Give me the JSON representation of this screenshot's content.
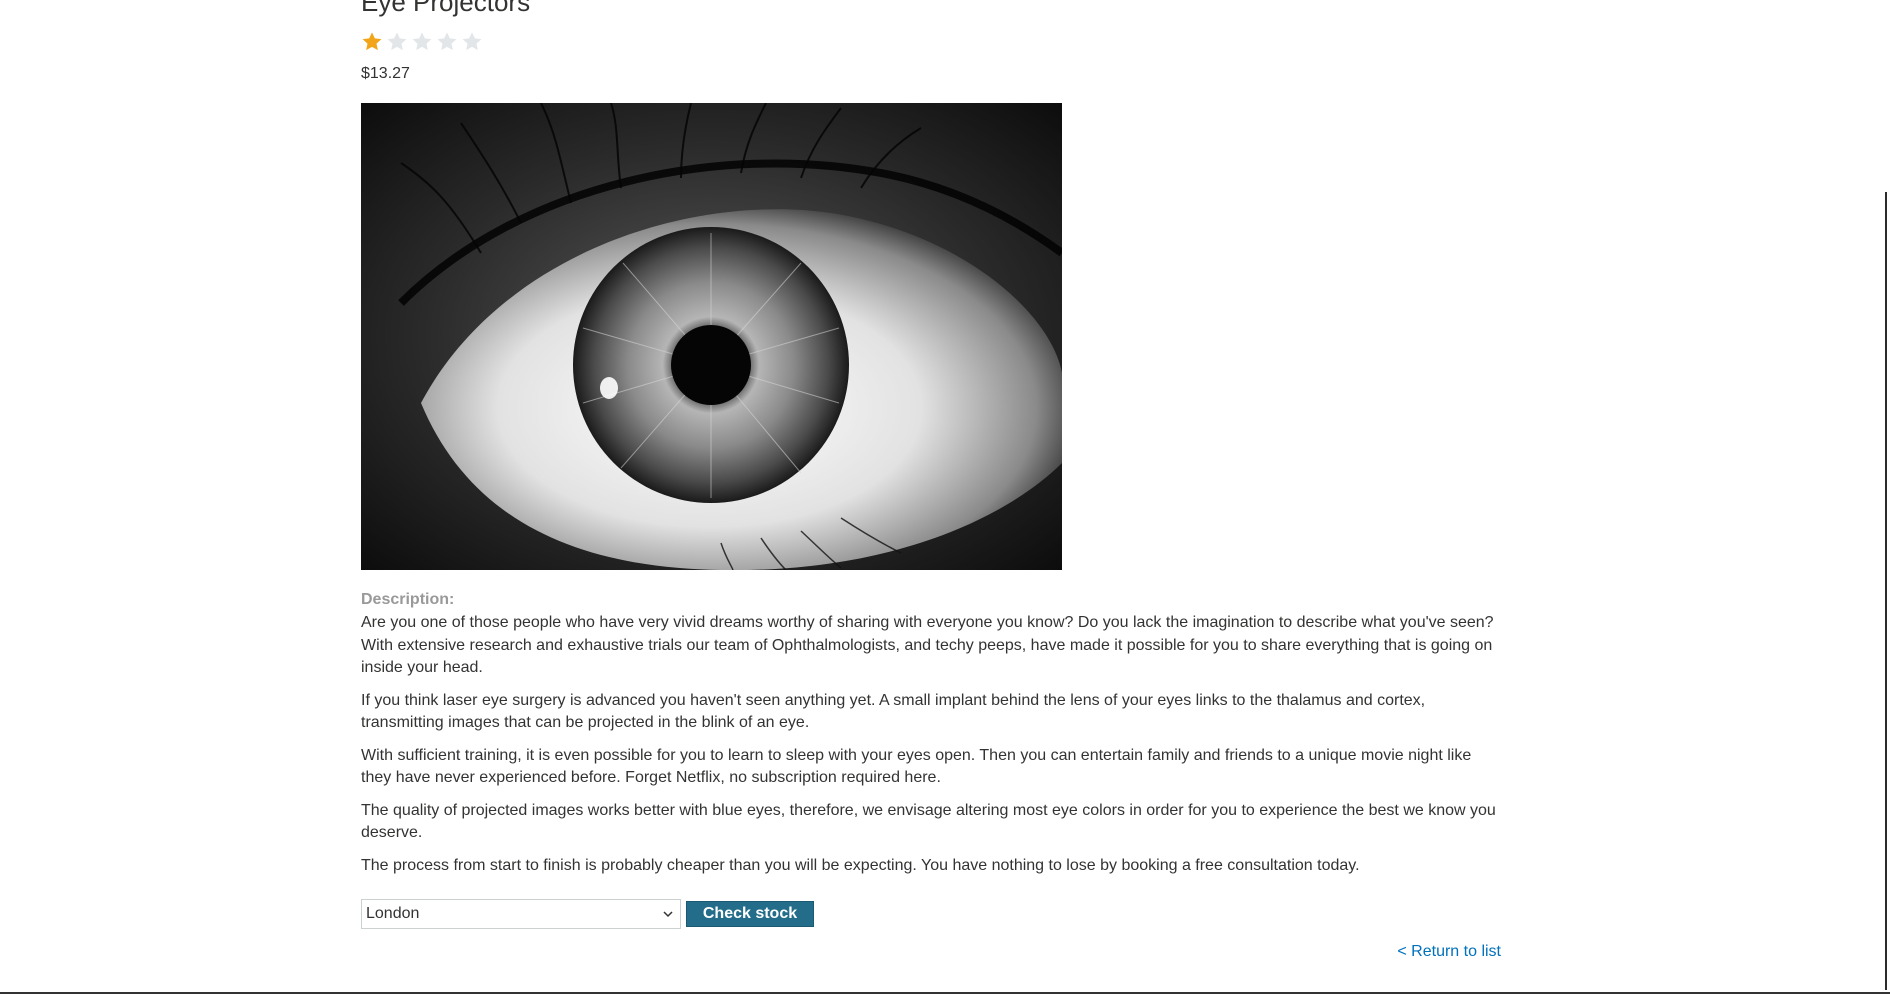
{
  "product": {
    "title": "Eye Projectors",
    "rating": {
      "value": 1,
      "max": 5
    },
    "price": "$13.27",
    "image_alt": "Close-up black and white eye"
  },
  "description": {
    "label": "Description:",
    "paragraphs": [
      "Are you one of those people who have very vivid dreams worthy of sharing with everyone you know? Do you lack the imagination to describe what you've seen? With extensive research and exhaustive trials our team of Ophthalmologists, and techy peeps, have made it possible for you to share everything that is going on inside your head.",
      "If you think laser eye surgery is advanced you haven't seen anything yet. A small implant behind the lens of your eyes links to the thalamus and cortex, transmitting images that can be projected in the blink of an eye.",
      "With sufficient training, it is even possible for you to learn to sleep with your eyes open. Then you can entertain family and friends to a unique movie night like they have never experienced before. Forget Netflix, no subscription required here.",
      "The quality of projected images works better with blue eyes, therefore, we envisage altering most eye colors in order for you to experience the best we know you deserve.",
      "The process from start to finish is probably cheaper than you will be expecting. You have nothing to lose by booking a free consultation today."
    ]
  },
  "stock_check": {
    "selected_store": "London",
    "button_label": "Check stock"
  },
  "navigation": {
    "return_link": "< Return to list"
  },
  "colors": {
    "star_filled": "#f2a51a",
    "star_empty": "#e3e6e8",
    "button_bg": "#236d8a",
    "link": "#0071bc",
    "label_gray": "#999999"
  }
}
